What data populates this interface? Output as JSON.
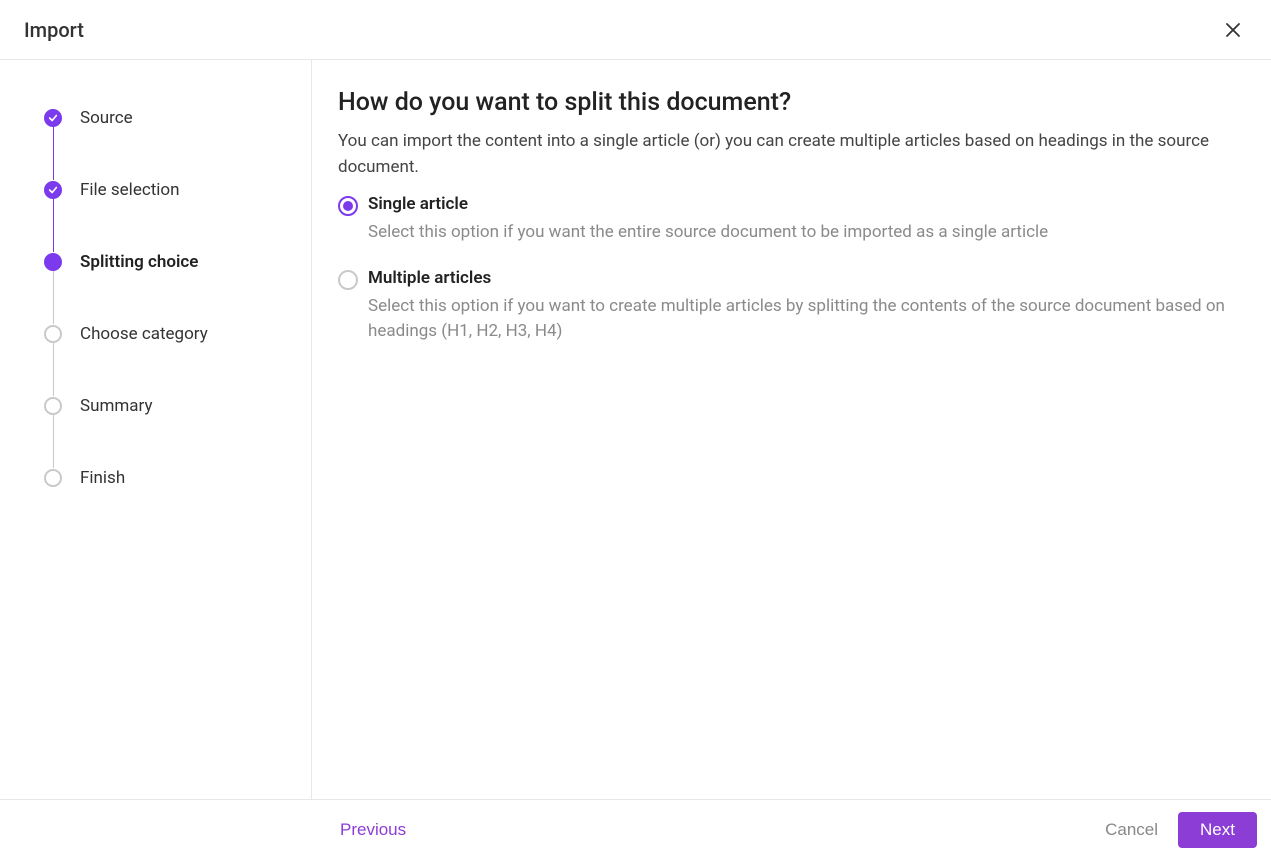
{
  "header": {
    "title": "Import"
  },
  "steps": [
    {
      "label": "Source",
      "state": "completed"
    },
    {
      "label": "File selection",
      "state": "completed"
    },
    {
      "label": "Splitting choice",
      "state": "current"
    },
    {
      "label": "Choose category",
      "state": "upcoming"
    },
    {
      "label": "Summary",
      "state": "upcoming"
    },
    {
      "label": "Finish",
      "state": "upcoming"
    }
  ],
  "main": {
    "heading": "How do you want to split this document?",
    "sub": "You can import the content into a single article (or) you can create multiple articles based on headings in the source document.",
    "options": [
      {
        "title": "Single article",
        "desc": "Select this option if you want the entire source document to be imported as a single article",
        "selected": true
      },
      {
        "title": "Multiple articles",
        "desc": "Select this option if you want to create multiple articles by splitting the contents of the source document based on headings (H1, H2, H3, H4)",
        "selected": false
      }
    ]
  },
  "footer": {
    "previous": "Previous",
    "cancel": "Cancel",
    "next": "Next"
  },
  "colors": {
    "accent": "#7c3aed"
  }
}
